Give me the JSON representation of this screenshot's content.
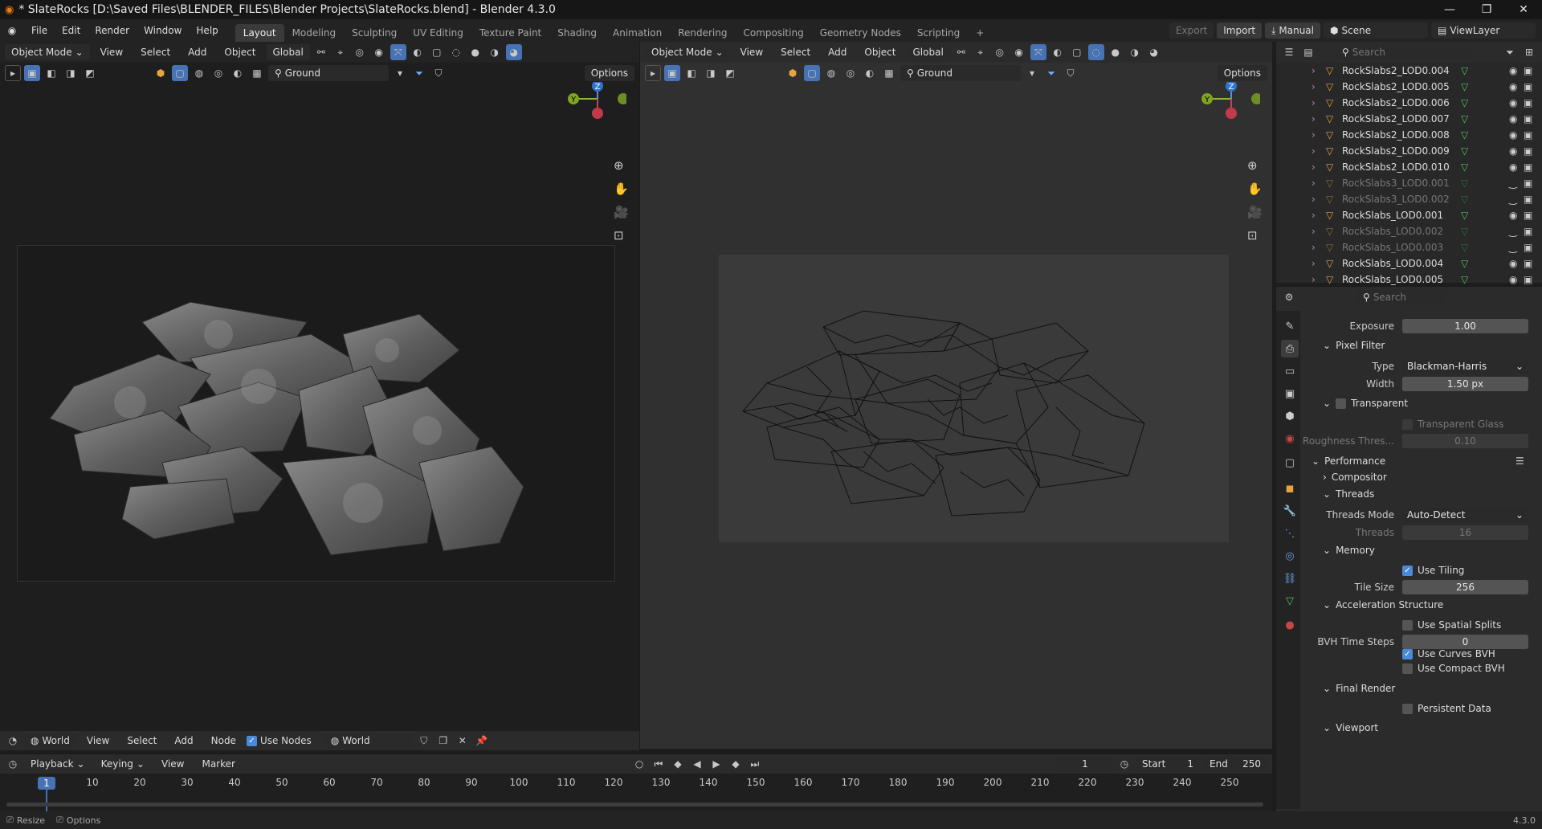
{
  "titlebar": {
    "title": "* SlateRocks [D:\\Saved Files\\BLENDER_FILES\\Blender Projects\\SlateRocks.blend] - Blender 4.3.0"
  },
  "menubar": {
    "menus": [
      "File",
      "Edit",
      "Render",
      "Window",
      "Help"
    ],
    "workspaces": [
      "Layout",
      "Modeling",
      "Sculpting",
      "UV Editing",
      "Texture Paint",
      "Shading",
      "Animation",
      "Rendering",
      "Compositing",
      "Geometry Nodes",
      "Scripting"
    ],
    "export_label": "Export",
    "import_label": "Import",
    "manual_label": "Manual",
    "scene": "Scene",
    "view_layer": "ViewLayer"
  },
  "viewport_left": {
    "mode": "Object Mode",
    "menus": [
      "View",
      "Select",
      "Add",
      "Object"
    ],
    "orientation": "Global",
    "search_value": "Ground",
    "options_label": "Options"
  },
  "viewport_right": {
    "mode": "Object Mode",
    "menus": [
      "View",
      "Select",
      "Add",
      "Object"
    ],
    "orientation": "Global",
    "search_value": "Ground",
    "options_label": "Options"
  },
  "gizmo": {
    "z": "Z",
    "y": "Y"
  },
  "outliner": {
    "search_placeholder": "Search",
    "items": [
      {
        "name": "RockSlabs2_LOD0.004",
        "dim": false
      },
      {
        "name": "RockSlabs2_LOD0.005",
        "dim": false
      },
      {
        "name": "RockSlabs2_LOD0.006",
        "dim": false
      },
      {
        "name": "RockSlabs2_LOD0.007",
        "dim": false
      },
      {
        "name": "RockSlabs2_LOD0.008",
        "dim": false
      },
      {
        "name": "RockSlabs2_LOD0.009",
        "dim": false
      },
      {
        "name": "RockSlabs2_LOD0.010",
        "dim": false
      },
      {
        "name": "RockSlabs3_LOD0.001",
        "dim": true
      },
      {
        "name": "RockSlabs3_LOD0.002",
        "dim": true
      },
      {
        "name": "RockSlabs_LOD0.001",
        "dim": false
      },
      {
        "name": "RockSlabs_LOD0.002",
        "dim": true
      },
      {
        "name": "RockSlabs_LOD0.003",
        "dim": true
      },
      {
        "name": "RockSlabs_LOD0.004",
        "dim": false
      },
      {
        "name": "RockSlabs_LOD0.005",
        "dim": false
      }
    ]
  },
  "properties": {
    "search_placeholder": "Search",
    "exposure_label": "Exposure",
    "exposure_value": "1.00",
    "pixel_filter": "Pixel Filter",
    "type_label": "Type",
    "type_value": "Blackman-Harris",
    "width_label": "Width",
    "width_value": "1.50 px",
    "transparent": "Transparent",
    "transparent_glass": "Transparent Glass",
    "roughness_label": "Roughness Thres...",
    "roughness_value": "0.10",
    "performance": "Performance",
    "compositor": "Compositor",
    "threads": "Threads",
    "threads_mode_label": "Threads Mode",
    "threads_mode_value": "Auto-Detect",
    "threads_label": "Threads",
    "threads_value": "16",
    "memory": "Memory",
    "use_tiling": "Use Tiling",
    "tile_size_label": "Tile Size",
    "tile_size_value": "256",
    "accel": "Acceleration Structure",
    "spatial_splits": "Use Spatial Splits",
    "bvh_label": "BVH Time Steps",
    "bvh_value": "0",
    "curves_bvh": "Use Curves BVH",
    "compact_bvh": "Use Compact BVH",
    "final_render": "Final Render",
    "persistent": "Persistent Data",
    "viewport": "Viewport"
  },
  "node_header": {
    "world_type": "World",
    "menus": [
      "View",
      "Select",
      "Add",
      "Node"
    ],
    "use_nodes": "Use Nodes",
    "world_name": "World"
  },
  "timeline": {
    "menus": [
      "Playback",
      "Keying",
      "View",
      "Marker"
    ],
    "current_frame": "1",
    "start_label": "Start",
    "start_value": "1",
    "end_label": "End",
    "end_value": "250",
    "ticks": [
      "10",
      "20",
      "30",
      "40",
      "50",
      "60",
      "70",
      "80",
      "90",
      "100",
      "110",
      "120",
      "130",
      "140",
      "150",
      "160",
      "170",
      "180",
      "190",
      "200",
      "210",
      "220",
      "230",
      "240",
      "250"
    ],
    "playhead": "1"
  },
  "statusbar": {
    "resize": "Resize",
    "options": "Options",
    "version": "4.3.0"
  }
}
